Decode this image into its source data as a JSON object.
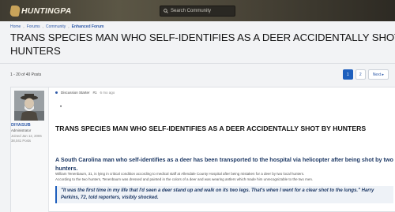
{
  "site": {
    "logo_text": "HUNTINGPA"
  },
  "search": {
    "placeholder": "Search Community"
  },
  "breadcrumb": [
    "Home",
    "Forums",
    "Community",
    "Enhanced Forum"
  ],
  "thread": {
    "title_line1": "TRANS SPECIES MAN WHO SELF-IDENTIFIES AS A DEER ACCIDENTALLY SHOT B",
    "title_line2": "HUNTERS"
  },
  "pagination": {
    "range": "1 - 20 of 40 Posts",
    "pages": [
      "1",
      "2"
    ],
    "next_label": "Next ▸"
  },
  "post": {
    "author": "DIYASUB",
    "role": "Administrator",
    "join_line1": "Joined Jan 12, 2006",
    "join_line2": "38,041 Posts",
    "badge": "Discussion Starter",
    "post_no": "#1",
    "time": "6 mo ago",
    "bullet": "•",
    "heading": "TRANS SPECIES MAN WHO SELF-IDENTIFIES AS A DEER ACCIDENTALLY SHOT BY HUNTERS",
    "lead": "A South Carolina man who self-identifies as a deer has been transported to the hospital via helicopter after being shot by two hunters.",
    "line1": "William Tenenbaum, 31, is lying in critical condition according to medical staff at Allendale County Hospital after being mistaken for a deer by two local hunters.",
    "line2": "According to the two hunters, Tenenbaum was dressed and painted in the colors of a deer and was wearing antlers which made him unrecognizable to the two men.",
    "quote": "\"It was the first time in my life that I'd seen a deer stand up and walk on its two legs. That's when I went for a clear shot to the lungs.\" Harry Perkins, 72, told reporters, visibly shocked."
  },
  "colors": {
    "accent": "#1e5fbd",
    "link": "#2f5aa8",
    "header_bg": "#4a4538"
  }
}
